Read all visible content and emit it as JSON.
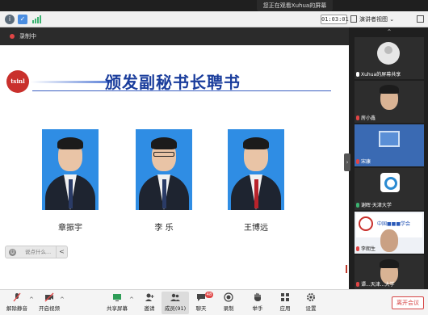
{
  "notice": {
    "text": "您正在观看Xuhua的屏幕"
  },
  "topbar": {
    "timer": "01:03:01",
    "view_label": "演讲者视图 ⌄"
  },
  "recording": {
    "label": "录制中"
  },
  "slide": {
    "logo_text": "tsinl",
    "title": "颁发副秘书长聘书",
    "names": [
      "章振宇",
      "李 乐",
      "王博远"
    ]
  },
  "comment": {
    "placeholder": "说点什么...",
    "collapse": "<"
  },
  "sidebar": {
    "collapse": "⌃",
    "handle": "›",
    "tiles": [
      {
        "label": "Xuhua的屏幕共享"
      },
      {
        "label": "房小鑫"
      },
      {
        "label": "宋康"
      },
      {
        "label": "谢晖·天津大学"
      },
      {
        "label": "李朗生",
        "banner": "中国■■■学会"
      },
      {
        "label": "谭...天津...大学"
      }
    ]
  },
  "toolbar": {
    "items": [
      {
        "label": "解除静音"
      },
      {
        "label": "开启视频"
      },
      {
        "label": "共享屏幕"
      },
      {
        "label": "邀请"
      },
      {
        "label": "成员(91)"
      },
      {
        "label": "聊天",
        "badge": "48"
      },
      {
        "label": "录制"
      },
      {
        "label": "举手"
      },
      {
        "label": "应用"
      },
      {
        "label": "设置"
      }
    ],
    "leave": "离开会议",
    "caret": "^"
  },
  "colors": {
    "title_blue": "#1a3d9c",
    "photo_bg": "#2f8de4",
    "leave_red": "#d64545",
    "record_red": "#e04545"
  }
}
